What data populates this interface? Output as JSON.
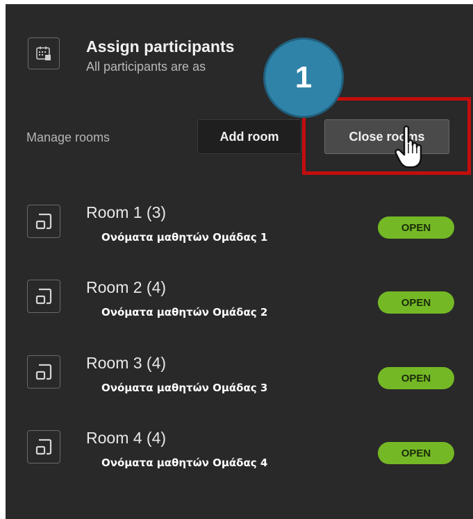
{
  "assign": {
    "title": "Assign participants",
    "subtitle": "All participants are as"
  },
  "manage": {
    "label": "Manage rooms",
    "add_room_label": "Add room",
    "close_rooms_label": "Close rooms"
  },
  "callout": {
    "step_number": "1"
  },
  "rooms": [
    {
      "name": "Room 1 (3)",
      "students": "Ονόματα μαθητών Ομάδας 1",
      "status": "OPEN"
    },
    {
      "name": "Room 2 (4)",
      "students": "Ονόματα μαθητών Ομάδας 2",
      "status": "OPEN"
    },
    {
      "name": "Room 3 (4)",
      "students": "Ονόματα μαθητών Ομάδας 3",
      "status": "OPEN"
    },
    {
      "name": "Room 4 (4)",
      "students": "Ονόματα μαθητών Ομάδας 4",
      "status": "OPEN"
    }
  ],
  "colors": {
    "panel_bg": "#292929",
    "open_badge": "#74b925",
    "highlight": "#c40d0d",
    "callout": "#2f83a8"
  },
  "icons": {
    "assign": "calendar-grid-icon",
    "room": "breakout-room-icon",
    "cursor": "hand-pointer-icon"
  }
}
